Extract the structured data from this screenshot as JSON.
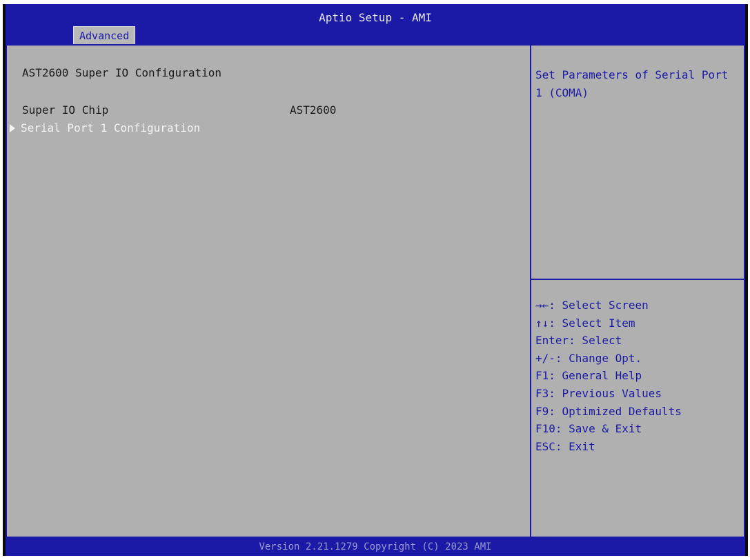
{
  "header": {
    "title": "Aptio Setup - AMI",
    "active_tab": "Advanced"
  },
  "main": {
    "page_title": "AST2600 Super IO Configuration",
    "rows": [
      {
        "label": "Super IO Chip",
        "value": "AST2600"
      }
    ],
    "submenu_item": "Serial Port 1 Configuration"
  },
  "help": {
    "description": "Set Parameters of Serial Port 1 (COMA)",
    "keys": [
      "→←: Select Screen",
      "↑↓: Select Item",
      "Enter: Select",
      "+/-: Change Opt.",
      "F1: General Help",
      "F3: Previous Values",
      "F9: Optimized Defaults",
      "F10: Save & Exit",
      "ESC: Exit"
    ]
  },
  "footer": {
    "text": "Version 2.21.1279 Copyright (C) 2023 AMI"
  },
  "colors": {
    "frame_blue": "#1a1aa6",
    "panel_gray": "#b0b0b0",
    "selected_text": "#f4f4f4"
  }
}
